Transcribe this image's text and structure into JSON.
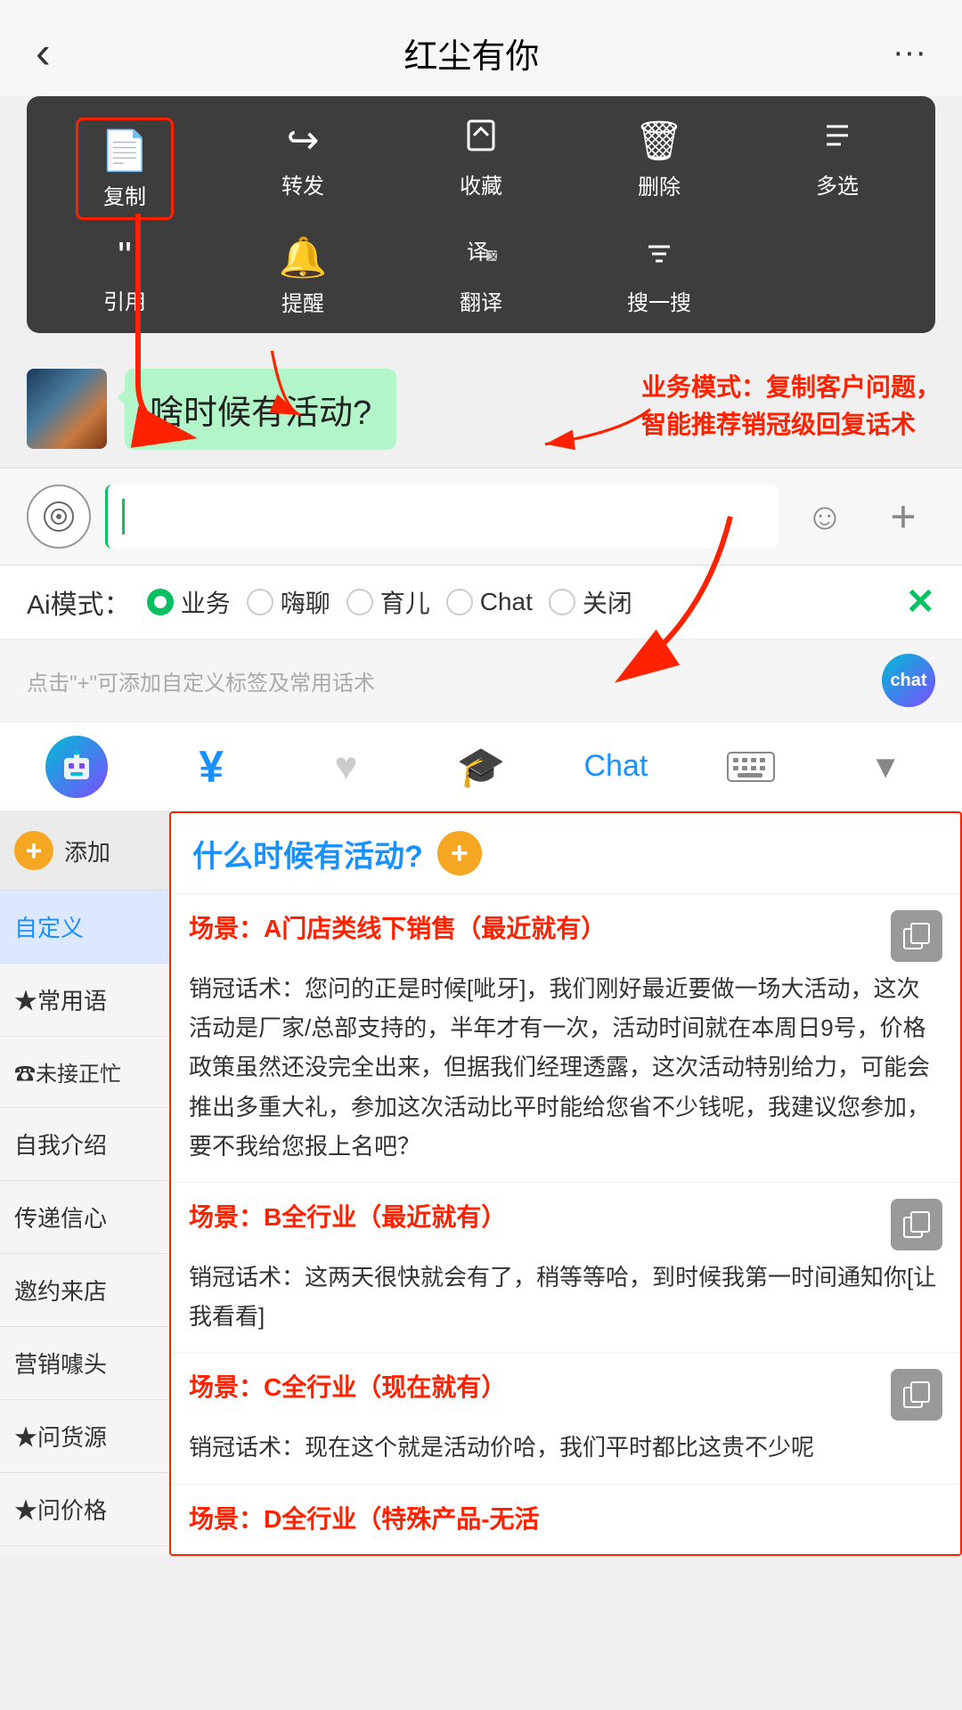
{
  "header": {
    "back_label": "‹",
    "title": "红尘有你",
    "more_label": "···"
  },
  "context_menu": {
    "row1": [
      {
        "label": "复制",
        "icon": "📄",
        "highlighted": true
      },
      {
        "label": "转发",
        "icon": "↪"
      },
      {
        "label": "收藏",
        "icon": "🎁"
      },
      {
        "label": "删除",
        "icon": "🗑"
      },
      {
        "label": "多选",
        "icon": "☰"
      }
    ],
    "row2": [
      {
        "label": "引用",
        "icon": "❝"
      },
      {
        "label": "提醒",
        "icon": "🔔"
      },
      {
        "label": "翻译",
        "icon": "译"
      },
      {
        "label": "搜一搜",
        "icon": "✕"
      }
    ]
  },
  "chat": {
    "bubble_text": "啥时候有活动?",
    "annotation": "业务模式：复制客户问题，\n智能推荐销冠级回复话术"
  },
  "input_bar": {
    "placeholder": ""
  },
  "ai_mode": {
    "label": "Ai模式：",
    "options": [
      "业务",
      "嗨聊",
      "育儿",
      "Chat",
      "关闭"
    ],
    "active": "业务",
    "close_icon": "✕"
  },
  "hint_bar": {
    "text": "点击\"+\"可添加自定义标签及常用话术"
  },
  "toolbar": {
    "items": [
      {
        "icon": "robot",
        "label": "chat"
      },
      {
        "icon": "¥",
        "label": "yen"
      },
      {
        "icon": "♥",
        "label": "heart"
      },
      {
        "icon": "🎓",
        "label": "hat"
      },
      {
        "icon": "Chat",
        "label": "chat-text"
      },
      {
        "icon": "⌨",
        "label": "keyboard"
      },
      {
        "icon": "▼",
        "label": "arrow"
      }
    ]
  },
  "sidebar": {
    "add_label": "添加",
    "items": [
      {
        "label": "自定义",
        "active": true
      },
      {
        "label": "★常用语",
        "active": false
      },
      {
        "label": "☎未接正忙",
        "active": false
      },
      {
        "label": "自我介绍",
        "active": false
      },
      {
        "label": "传递信心",
        "active": false
      },
      {
        "label": "邀约来店",
        "active": false
      },
      {
        "label": "营销噱头",
        "active": false
      },
      {
        "label": "★问货源",
        "active": false
      },
      {
        "label": "★问价格",
        "active": false
      }
    ]
  },
  "panel": {
    "title": "什么时候有活动?",
    "scenarios": [
      {
        "label": "场景：A门店类线下销售（最近就有）",
        "content": "销冠话术：您问的正是时候[呲牙]，我们刚好最近要做一场大活动，这次活动是厂家/总部支持的，半年才有一次，活动时间就在本周日9号，价格政策虽然还没完全出来，但据我们经理透露，这次活动特别给力，可能会推出多重大礼，参加这次活动比平时能给您省不少钱呢，我建议您参加，要不我给您报上名吧？"
      },
      {
        "label": "场景：B全行业（最近就有）",
        "content": "销冠话术：这两天很快就会有了，稍等等哈，到时候我第一时间通知你[让我看看]"
      },
      {
        "label": "场景：C全行业（现在就有）",
        "content": "销冠话术：现在这个就是活动价哈，我们平时都比这贵不少呢"
      },
      {
        "label": "场景：D全行业（特殊产品-无活",
        "content": ""
      }
    ]
  }
}
